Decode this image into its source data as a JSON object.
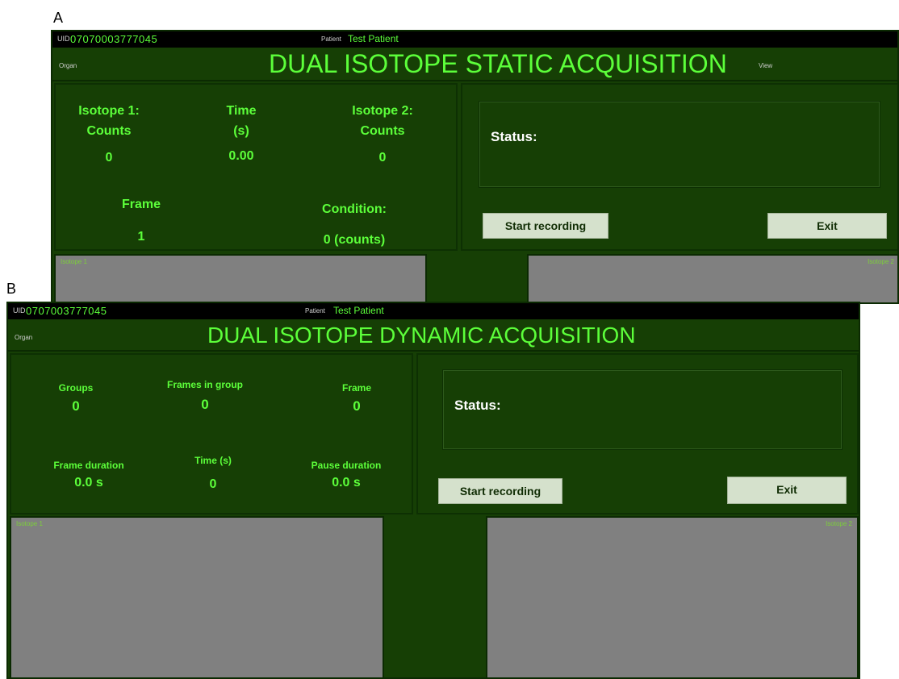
{
  "panel_labels": {
    "a": "A",
    "b": "B"
  },
  "colors": {
    "app_bg": "#163f05",
    "accent_text": "#5cff3a",
    "button_bg": "#d5e1cc",
    "image_bg": "#808080"
  },
  "screen_a": {
    "uid_label": "UID",
    "uid_value": "07070003777045",
    "patient_label": "Patient",
    "patient_value": "Test Patient",
    "organ_label": "Organ",
    "title": "DUAL ISOTOPE STATIC ACQUISITION",
    "view_label": "View",
    "isotope1": {
      "label1": "Isotope 1:",
      "label2": "Counts",
      "value": "0"
    },
    "time": {
      "label1": "Time",
      "label2": "(s)",
      "value": "0.00"
    },
    "isotope2": {
      "label1": "Isotope 2:",
      "label2": "Counts",
      "value": "0"
    },
    "frame": {
      "label": "Frame",
      "value": "1"
    },
    "condition": {
      "label": "Condition:",
      "value": "0 (counts)"
    },
    "status_label": "Status:",
    "start_button": "Start recording",
    "exit_button": "Exit",
    "image_left_label": "Isotope 1",
    "image_right_label": "Isotope 2"
  },
  "screen_b": {
    "uid_label": "UID",
    "uid_value": "0707003777045",
    "patient_label": "Patient",
    "patient_value": "Test Patient",
    "organ_label": "Organ",
    "title": "DUAL ISOTOPE DYNAMIC ACQUISITION",
    "groups": {
      "label": "Groups",
      "value": "0"
    },
    "frames_in_group": {
      "label": "Frames in group",
      "value": "0"
    },
    "frame": {
      "label": "Frame",
      "value": "0"
    },
    "frame_duration": {
      "label": "Frame duration",
      "value": "0.0 s"
    },
    "time": {
      "label": "Time (s)",
      "value": "0"
    },
    "pause_duration": {
      "label": "Pause duration",
      "value": "0.0 s"
    },
    "status_label": "Status:",
    "start_button": "Start recording",
    "exit_button": "Exit",
    "image_left_label": "Isotope 1",
    "image_right_label": "Isotope 2"
  }
}
